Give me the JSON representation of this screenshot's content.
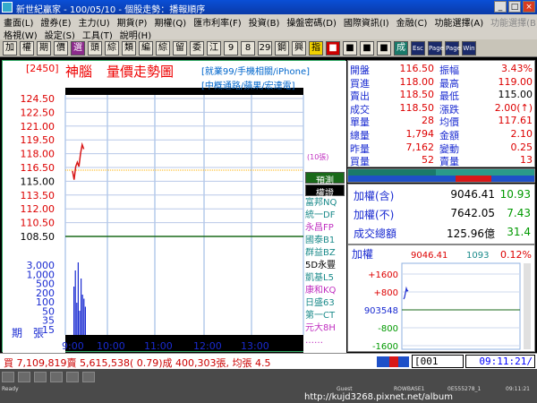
{
  "window": {
    "title": "新世紀贏家 - 100/05/10 - 個股走勢：播報順序",
    "buttons": [
      "_",
      "□",
      "×"
    ]
  },
  "menus": {
    "row1": [
      "畫面(L)",
      "證券(E)",
      "主力(U)",
      "期貨(P)",
      "期權(Q)",
      "匯市利率(F)",
      "投資(B)",
      "操盤密碼(D)",
      "國際資訊(I)",
      "金融(C)",
      "功能選擇(A)",
      "功能選擇(B)"
    ],
    "row2": [
      "格視(W)",
      "設定(S)",
      "工具(T)",
      "說明(H)"
    ]
  },
  "toolbar": [
    {
      "label": "加",
      "style": ""
    },
    {
      "label": "權",
      "style": ""
    },
    {
      "label": "期",
      "style": ""
    },
    {
      "label": "價",
      "style": ""
    },
    {
      "label": "選",
      "style": "purple"
    },
    {
      "label": "頭",
      "style": ""
    },
    {
      "label": "綜",
      "style": ""
    },
    {
      "label": "類",
      "style": ""
    },
    {
      "label": "編",
      "style": ""
    },
    {
      "label": "綜",
      "style": ""
    },
    {
      "label": "留",
      "style": ""
    },
    {
      "label": "委",
      "style": ""
    },
    {
      "label": "江",
      "style": ""
    },
    {
      "label": "9",
      "style": ""
    },
    {
      "label": "8",
      "style": ""
    },
    {
      "label": "29",
      "style": ""
    },
    {
      "label": "鋼",
      "style": ""
    },
    {
      "label": "興",
      "style": ""
    },
    {
      "label": "指",
      "style": "yellow"
    },
    {
      "label": "■",
      "style": "red"
    },
    {
      "label": "■",
      "style": ""
    },
    {
      "label": "■",
      "style": ""
    },
    {
      "label": "■",
      "style": ""
    },
    {
      "label": "成",
      "style": "teal"
    },
    {
      "label": "Esc",
      "style": "dark"
    },
    {
      "label": "Page",
      "style": "dark"
    },
    {
      "label": "Page",
      "style": "dark"
    },
    {
      "label": "Win",
      "style": "dark"
    }
  ],
  "stock": {
    "code": "[2450]",
    "name": "神腦",
    "chart_kind": "量價走勢圖",
    "tags_line1": "[就業99/手機相關/iPhone]",
    "tags_line2": "[中概通路/蘋果/宏達電]",
    "unit_label": "(10張)",
    "y_axis_bottom_label_1": "期",
    "y_axis_bottom_label_2": "張"
  },
  "chart_data": {
    "type": "line",
    "price_ticks": [
      "124.50",
      "122.50",
      "121.00",
      "119.50",
      "118.00",
      "116.50",
      "115.00",
      "113.50",
      "112.00",
      "110.50",
      "108.50"
    ],
    "reference_price": 115.0,
    "price_range": [
      108.5,
      124.5
    ],
    "volume_ticks": [
      "3,000",
      "1,000",
      "500",
      "200",
      "100",
      "50",
      "35",
      "15"
    ],
    "time_ticks": [
      "9:00",
      "10:00",
      "11:00",
      "12:00",
      "13:00"
    ],
    "price_series": [
      {
        "t": "9:00",
        "p": 116.0
      },
      {
        "t": "9:01",
        "p": 115.0
      },
      {
        "t": "9:02",
        "p": 116.5
      },
      {
        "t": "9:03",
        "p": 117.0
      },
      {
        "t": "9:04",
        "p": 116.5
      },
      {
        "t": "9:05",
        "p": 118.0
      },
      {
        "t": "9:06",
        "p": 119.0
      },
      {
        "t": "9:07",
        "p": 118.5
      }
    ],
    "volume_series": [
      60,
      80,
      40,
      90,
      30,
      70,
      50,
      45,
      35
    ]
  },
  "broker": {
    "header1": "預測",
    "header2": "權證",
    "items": [
      {
        "text": "富邦NQ",
        "color": "#1a8a8a"
      },
      {
        "text": "統一DF",
        "color": "#1a8a8a"
      },
      {
        "text": "永昌FP",
        "color": "#c02fc0"
      },
      {
        "text": "國泰B1",
        "color": "#1a8a8a"
      },
      {
        "text": "群益BZ",
        "color": "#1a8a8a"
      },
      {
        "text": "5D永豐",
        "color": "#000000"
      },
      {
        "text": "凱基L5",
        "color": "#1a8a8a"
      },
      {
        "text": "康和KQ",
        "color": "#c02fc0"
      },
      {
        "text": "日盛63",
        "color": "#1a8a8a"
      },
      {
        "text": "第一CT",
        "color": "#1a8a8a"
      },
      {
        "text": "元大8H",
        "color": "#c02fc0"
      },
      {
        "text": "……",
        "color": "#c02fc0"
      }
    ]
  },
  "quote": {
    "rows": [
      {
        "l1": "開盤",
        "v1": "116.50",
        "l2": "振幅",
        "v2": "3.43%",
        "c1": "#d00",
        "c2": "#d00"
      },
      {
        "l1": "買進",
        "v1": "118.00",
        "l2": "最高",
        "v2": "119.00",
        "c1": "#d00",
        "c2": "#d00"
      },
      {
        "l1": "賣出",
        "v1": "118.50",
        "l2": "最低",
        "v2": "115.00",
        "c1": "#d00",
        "c2": "#000"
      },
      {
        "l1": "成交",
        "v1": "118.50",
        "l2": "漲跌",
        "v2": "2.00(↑)",
        "c1": "#d00",
        "c2": "#d00"
      },
      {
        "l1": "單量",
        "v1": "28",
        "l2": "均價",
        "v2": "117.61",
        "c1": "#d00",
        "c2": "#d00"
      },
      {
        "l1": "總量",
        "v1": "1,794",
        "l2": "金額",
        "v2": "2.10",
        "c1": "#d00",
        "c2": "#d00"
      },
      {
        "l1": "昨量",
        "v1": "7,162",
        "l2": "變動",
        "v2": "0.25",
        "c1": "#d00",
        "c2": "#d00"
      },
      {
        "l1": "買量",
        "v1": "52",
        "l2": "賣量",
        "v2": "13",
        "c1": "#d00",
        "c2": "#d00"
      }
    ]
  },
  "summary": {
    "rows": [
      {
        "label": "加權(含)",
        "value": "9046.41",
        "pct": "10.93"
      },
      {
        "label": "加權(不)",
        "value": "7642.05",
        "pct": "7.43"
      },
      {
        "label": "成交總額",
        "value": "125.96億",
        "pct": "31.4"
      }
    ]
  },
  "index": {
    "label": "加權",
    "value": "9046.41",
    "volume": "1093",
    "change_pct": "0.12%",
    "ticks": [
      "+1600",
      "+800",
      "903548",
      "-800",
      "-1600"
    ]
  },
  "trade": {
    "text": "買 7,109,819賣 5,615,538( 0.79)成 400,303張, 均張 4.5",
    "code": "[001",
    "clock": "09:11:21/"
  },
  "taskbar": {
    "status_left": "Ready",
    "status_mid1": "Guest",
    "status_mid2": "ROWBASE1",
    "status_mid3": "0E555278_1",
    "status_right": "09:11:21",
    "url": "http://kujd3268.pixnet.net/album"
  }
}
